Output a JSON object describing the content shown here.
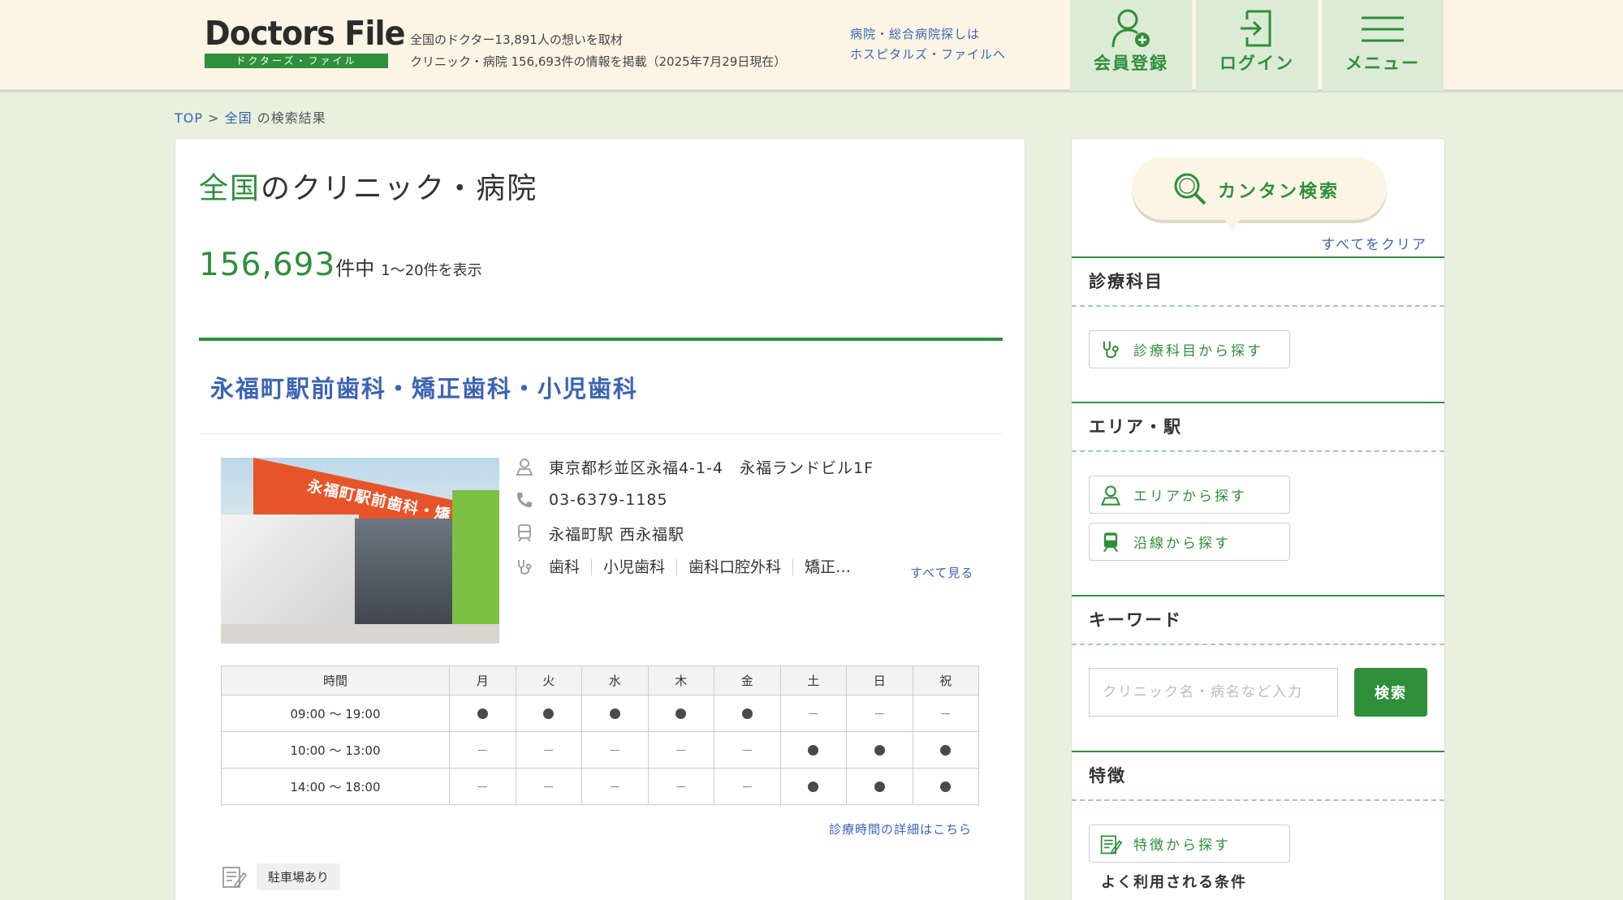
{
  "header": {
    "logo_main": "Doctors File",
    "logo_sub": "ドクターズ・ファイル",
    "stats_line1": "全国のドクター13,891人の想いを取材",
    "stats_line2": "クリニック・病院 156,693件の情報を掲載（2025年7月29日現在）",
    "hospital_link_line1": "病院・総合病院探しは",
    "hospital_link_line2": "ホスピタルズ・ファイルへ",
    "nav": [
      {
        "label": "会員登録",
        "icon": "user-add-icon"
      },
      {
        "label": "ログイン",
        "icon": "login-icon"
      },
      {
        "label": "メニュー",
        "icon": "hamburger-menu-icon"
      }
    ]
  },
  "breadcrumb": {
    "top": "TOP",
    "sep": ">",
    "region": "全国",
    "suffix": "の検索結果"
  },
  "results": {
    "title_highlight": "全国",
    "title_rest": "のクリニック・病院",
    "count": "156,693",
    "count_unit": "件中",
    "range": "1〜20件を表示"
  },
  "clinic": {
    "name": "永福町駅前歯科・矯正歯科・小児歯科",
    "photo_sign": "永福町駅前歯科・矯正歯科・小児歯科",
    "address": "東京都杉並区永福4-1-4　永福ランドビル1F",
    "phone": "03-6379-1185",
    "stations": "永福町駅 西永福駅",
    "specialties": [
      "歯科",
      "小児歯科",
      "歯科口腔外科",
      "矯正…"
    ],
    "see_all": "すべて見る",
    "hours": {
      "header_time": "時間",
      "days": [
        "月",
        "火",
        "水",
        "木",
        "金",
        "土",
        "日",
        "祝"
      ],
      "rows": [
        {
          "time": "09:00 〜 19:00",
          "open": [
            true,
            true,
            true,
            true,
            true,
            false,
            false,
            false
          ]
        },
        {
          "time": "10:00 〜 13:00",
          "open": [
            false,
            false,
            false,
            false,
            false,
            true,
            true,
            true
          ]
        },
        {
          "time": "14:00 〜 18:00",
          "open": [
            false,
            false,
            false,
            false,
            false,
            true,
            true,
            true
          ]
        }
      ],
      "open_mark": "●",
      "closed_mark": "－"
    },
    "hours_detail_link": "診療時間の詳細はこちら",
    "feature_tag": "駐車場あり"
  },
  "sidebar": {
    "quick_search": "カンタン検索",
    "clear_all": "すべてをクリア",
    "sections": {
      "specialty": {
        "title": "診療科目",
        "button": "診療科目から探す"
      },
      "area": {
        "title": "エリア・駅",
        "area_button": "エリアから探す",
        "line_button": "沿線から探す"
      },
      "keyword": {
        "title": "キーワード",
        "placeholder": "クリニック名・病名など入力",
        "button": "検索"
      },
      "features": {
        "title": "特徴",
        "button": "特徴から探す",
        "sub_label": "よく利用される条件"
      }
    }
  },
  "colors": {
    "brand_green": "#2f8f3a",
    "link_blue": "#3c64b4",
    "header_bg": "#fcf5e6",
    "page_bg": "#e9f0de"
  }
}
